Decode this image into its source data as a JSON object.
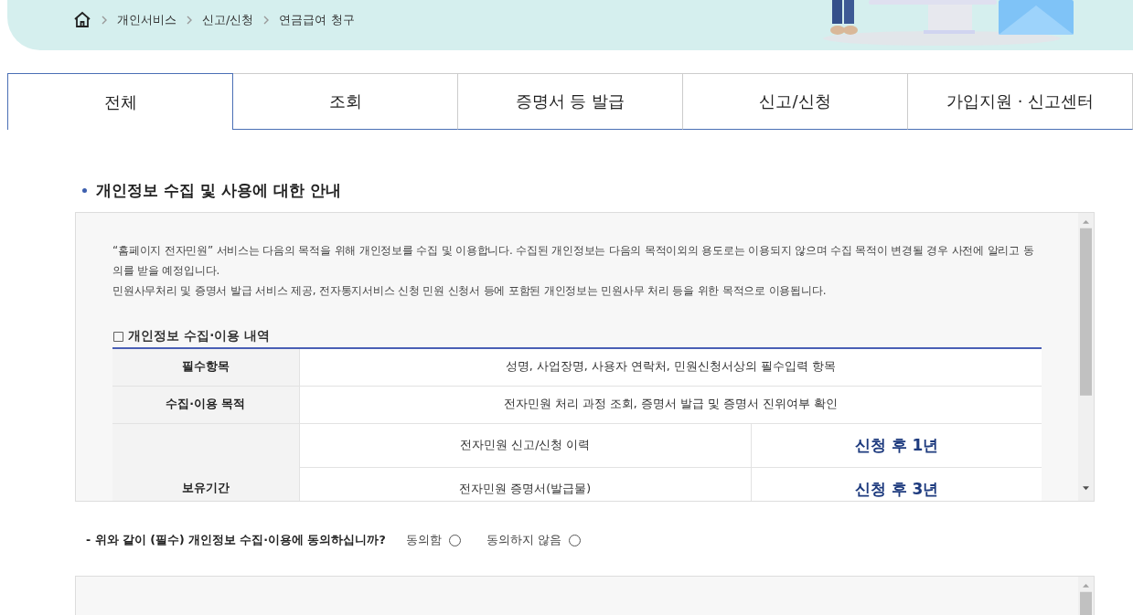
{
  "breadcrumb": [
    "개인서비스",
    "신고/신청",
    "연금급여 청구"
  ],
  "tabs": [
    {
      "label": "전체",
      "selected": true
    },
    {
      "label": "조회",
      "selected": false
    },
    {
      "label": "증명서 등 발급",
      "selected": false
    },
    {
      "label": "신고/신청",
      "selected": false
    },
    {
      "label": "가입지원 · 신고센터",
      "selected": false
    }
  ],
  "section_title": "개인정보 수집 및 사용에 대한 안내",
  "notice": {
    "paragraphs": [
      "“홈페이지 전자민원” 서비스는 다음의 목적을 위해 개인정보를 수집 및 이용합니다. 수집된 개인정보는 다음의 목적이외의 용도로는 이용되지 않으며 수집 목적이 변경될 경우 사전에 알리고 동의를 받을 예정입니다.",
      "민원사무처리 및 증명서 발급 서비스 제공, 전자통지서비스 신청 민원 신청서 등에 포함된 개인정보는 민원사무 처리 등을 위한 목적으로 이용됩니다."
    ],
    "table_title": "□ 개인정보 수집·이용 내역",
    "rows": [
      {
        "header": "필수항목",
        "value": "성명, 사업장명, 사용자 연락처, 민원신청서상의 필수입력 항목"
      },
      {
        "header": "수집·이용 목적",
        "value": "전자민원 처리 과정 조회, 증명서 발급 및 증명서 진위여부 확인"
      }
    ],
    "retention": {
      "header": "보유기간",
      "items": [
        {
          "item": "전자민원 신고/신청 이력",
          "period": "신청 후 1년"
        },
        {
          "item": "전자민원 증명서(발급물)",
          "period": "신청 후 3년"
        }
      ]
    }
  },
  "consent": {
    "question": "- 위와 같이 (필수) 개인정보 수집·이용에 동의하십니까?",
    "options": [
      {
        "label": "동의함",
        "selected": false
      },
      {
        "label": "동의하지 않음",
        "selected": false
      }
    ]
  }
}
